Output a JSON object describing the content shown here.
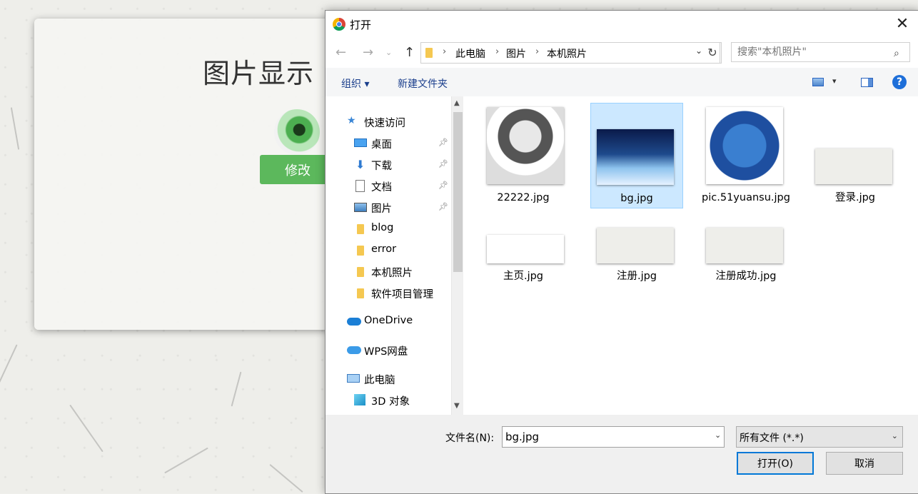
{
  "page": {
    "title": "图片显示",
    "edit_button": "修改"
  },
  "dialog": {
    "title": "打开",
    "breadcrumb": [
      "此电脑",
      "图片",
      "本机照片"
    ],
    "search_placeholder": "搜索\"本机照片\"",
    "toolbar": {
      "organize": "组织 ▾",
      "new_folder": "新建文件夹"
    },
    "nav": [
      {
        "label": "快速访问",
        "icon": "star-icon"
      },
      {
        "label": "桌面",
        "icon": "desktop-icon",
        "pinned": true
      },
      {
        "label": "下载",
        "icon": "download-icon",
        "pinned": true
      },
      {
        "label": "文档",
        "icon": "document-icon",
        "pinned": true
      },
      {
        "label": "图片",
        "icon": "pictures-icon",
        "pinned": true
      },
      {
        "label": "blog",
        "icon": "folder-icon"
      },
      {
        "label": "error",
        "icon": "folder-icon"
      },
      {
        "label": "本机照片",
        "icon": "folder-icon"
      },
      {
        "label": "软件项目管理",
        "icon": "folder-icon"
      },
      {
        "label": "OneDrive",
        "icon": "cloud-icon"
      },
      {
        "label": "WPS网盘",
        "icon": "cloud-icon"
      },
      {
        "label": "此电脑",
        "icon": "computer-icon"
      },
      {
        "label": "3D 对象",
        "icon": "cube-icon"
      }
    ],
    "files": [
      {
        "name": "22222.jpg",
        "selected": false
      },
      {
        "name": "bg.jpg",
        "selected": true
      },
      {
        "name": "pic.51yuansu.jpg",
        "selected": false
      },
      {
        "name": "登录.jpg",
        "selected": false
      },
      {
        "name": "主页.jpg",
        "selected": false
      },
      {
        "name": "注册.jpg",
        "selected": false
      },
      {
        "name": "注册成功.jpg",
        "selected": false
      }
    ],
    "filename_label": "文件名(N):",
    "filename_value": "bg.jpg",
    "filetype": "所有文件 (*.*)",
    "open_button": "打开(O)",
    "cancel_button": "取消"
  },
  "colors": {
    "accent": "#0078d7",
    "edit_button": "#5cb85c",
    "selected_bg": "#cce8ff",
    "link": "#1a3e8c"
  }
}
